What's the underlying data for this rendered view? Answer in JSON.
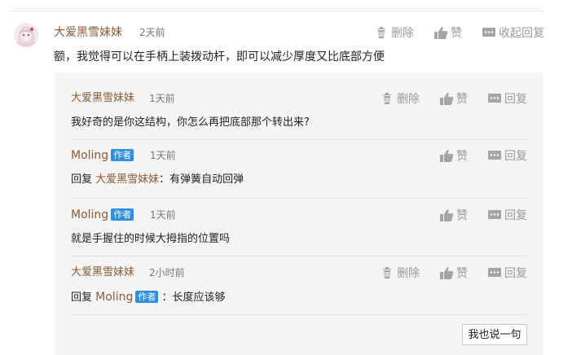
{
  "main_comment": {
    "author": "大爱黑雪妹妹",
    "time": "2天前",
    "text": "额，我觉得可以在手柄上装拨动杆，即可以减少厚度又比底部方便",
    "actions": {
      "delete": "删除",
      "like": "赞",
      "collapse": "收起回复"
    }
  },
  "replies": [
    {
      "author": "大爱黑雪妹妹",
      "is_author_badge": "",
      "time": "1天前",
      "text": "我好奇的是你这结构，你怎么再把底部那个转出来?",
      "reply_to": "",
      "reply_to_badge": "",
      "reply_prefix": "",
      "delete": "删除",
      "like": "赞",
      "reply": "回复"
    },
    {
      "author": "Moling",
      "is_author_badge": "作者",
      "time": "1天前",
      "text": "：有弹簧自动回弹",
      "reply_prefix": "回复",
      "reply_to": "大爱黑雪妹妹",
      "reply_to_badge": "",
      "delete": "",
      "like": "赞",
      "reply": "回复"
    },
    {
      "author": "Moling",
      "is_author_badge": "作者",
      "time": "1天前",
      "text": "就是手握住的时候大拇指的位置吗",
      "reply_prefix": "",
      "reply_to": "",
      "reply_to_badge": "",
      "delete": "",
      "like": "赞",
      "reply": "回复"
    },
    {
      "author": "大爱黑雪妹妹",
      "is_author_badge": "",
      "time": "2小时前",
      "text": "：长度应该够",
      "reply_prefix": "回复",
      "reply_to": "Moling",
      "reply_to_badge": "作者",
      "delete": "删除",
      "like": "赞",
      "reply": "回复"
    }
  ],
  "reply_button": "我也说一句",
  "colors": {
    "username": "#8b5a36",
    "badge": "#2f8fe0",
    "panel": "#f4f4f4"
  }
}
